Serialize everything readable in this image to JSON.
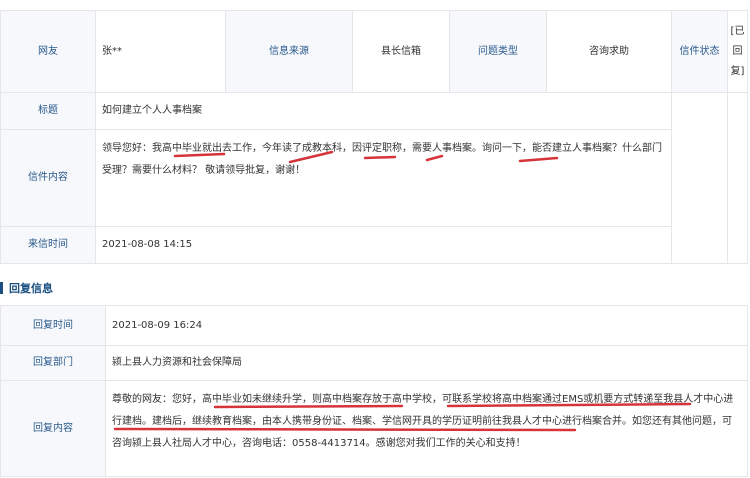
{
  "letter": {
    "user_label": "网友",
    "user_value": "张**",
    "source_label": "信息来源",
    "source_value": "县长信箱",
    "type_label": "问题类型",
    "type_value": "咨询求助",
    "status_label": "信件状态",
    "status_value": "[已回复]",
    "title_label": "标题",
    "title_value": "如何建立个人人事档案",
    "content_label": "信件内容",
    "content_value": "领导您好：我高中毕业就出去工作，今年读了成教本科，因评定职称，需要人事档案。询问一下，能否建立人事档案？什么部门受理？需要什么材料？ 敬请领导批复，谢谢！",
    "time_label": "来信时间",
    "time_value": "2021-08-08 14:15"
  },
  "reply_section_title": "回复信息",
  "reply": {
    "time_label": "回复时间",
    "time_value": "2021-08-09 16:24",
    "dept_label": "回复部门",
    "dept_value": "颍上县人力资源和社会保障局",
    "content_label": "回复内容",
    "content_value": "尊敬的网友：您好，高中毕业如未继续升学，则高中档案存放于高中学校，可联系学校将高中档案通过EMS或机要方式转递至我县人才中心进行建档。建档后，继续教育档案，由本人携带身份证、档案、学信网开具的学历证明前往我县人才中心进行档案合并。如您还有其他问题，可咨询颍上县人社局人才中心，咨询电话：0558-4413714。感谢您对我们工作的关心和支持！"
  },
  "annotation_color": "#d5343a"
}
